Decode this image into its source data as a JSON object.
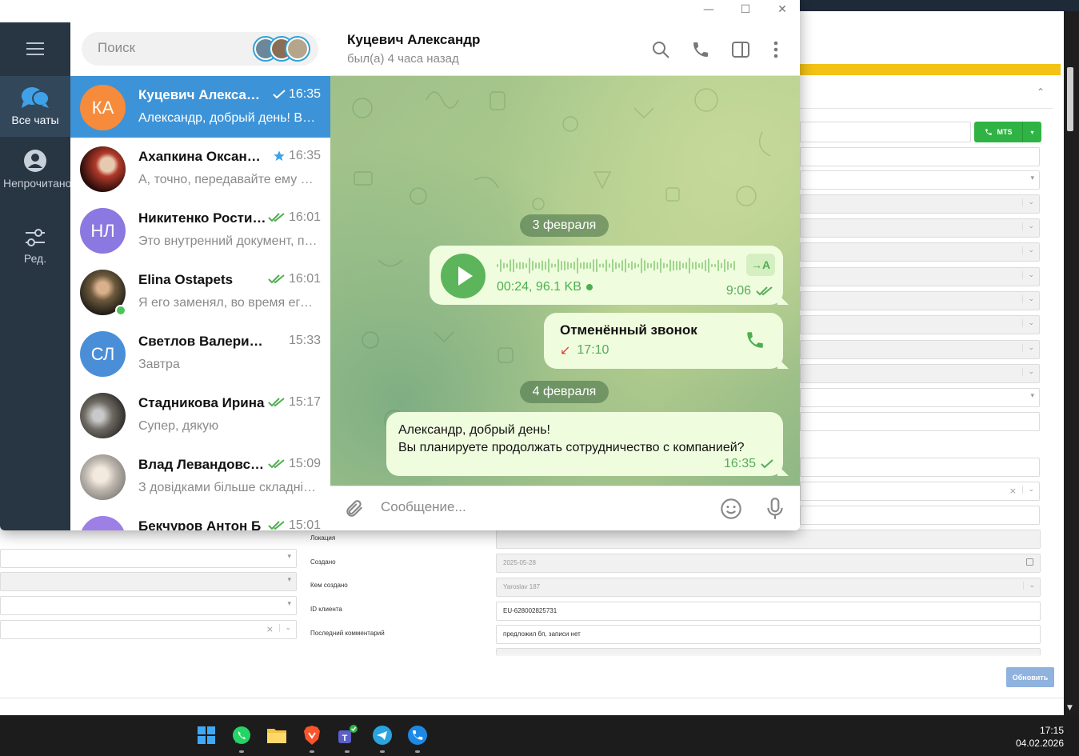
{
  "window": {
    "controls": {
      "minimize": "—",
      "maximize": "☐",
      "close": "✕"
    }
  },
  "folders": {
    "menu_icon": "hamburger-icon",
    "items": [
      {
        "label": "Все чаты",
        "icon": "chats-icon",
        "active": true
      },
      {
        "label": "Непрочитано",
        "icon": "user-icon",
        "active": false
      },
      {
        "label": "Ред.",
        "icon": "sliders-icon",
        "active": false
      }
    ]
  },
  "search": {
    "placeholder": "Поиск"
  },
  "chats": [
    {
      "initials": "КА",
      "avatar_color": "#f68b3b",
      "name": "Куцевич Александр",
      "time": "16:35",
      "status": "sent",
      "preview": "Александр, добрый день! Вы планируете продолжать сотрудничество с компанией?",
      "active": true
    },
    {
      "initials": "",
      "avatar_color": "#3a1410",
      "name": "Ахапкина Оксана Сергеевна",
      "time": "16:35",
      "status": "starred",
      "preview": "А, точно, передавайте ему привет",
      "active": false
    },
    {
      "initials": "НЛ",
      "avatar_color": "#8b78e0",
      "name": "Никитенко Ростислав Леонидович",
      "time": "16:01",
      "status": "read",
      "preview": "Это внутренний документ, поэтому",
      "active": false
    },
    {
      "initials": "",
      "avatar_color": "#3f3a2e",
      "name": "Elina Ostapets",
      "time": "16:01",
      "status": "read",
      "preview": "Я его заменял, во время его отпуска",
      "active": false,
      "online": true
    },
    {
      "initials": "СЛ",
      "avatar_color": "#4a8ed8",
      "name": "Светлов Валерий Леонидович",
      "time": "15:33",
      "status": "",
      "preview": "Завтра",
      "active": false
    },
    {
      "initials": "",
      "avatar_color": "#55504a",
      "name": "Стадникова Ирина",
      "time": "15:17",
      "status": "read",
      "preview": "Супер, дякую",
      "active": false
    },
    {
      "initials": "",
      "avatar_color": "#a9a9a9",
      "name": "Влад Левандовський",
      "time": "15:09",
      "status": "read",
      "preview": "З довідками більше складністей",
      "active": false
    },
    {
      "initials": "",
      "avatar_color": "#9d7fe6",
      "name": "Бекчуров Антон Б",
      "time": "15:01",
      "status": "read",
      "preview": "",
      "active": false
    }
  ],
  "peer": {
    "name": "Куцевич Александр",
    "status": "был(а) 4 часа назад"
  },
  "header_icons": [
    "search-icon",
    "phone-icon",
    "sidebar-icon",
    "more-icon"
  ],
  "messages": {
    "date1": "3 февраля",
    "voice": {
      "duration": "00:24, 96.1 KB",
      "time": "9:06",
      "transcribe": "→A"
    },
    "call": {
      "title": "Отменённый звонок",
      "time": "17:10"
    },
    "date2": "4 февраля",
    "text": {
      "line1": "Александр, добрый день!",
      "line2": "Вы планируете продолжать сотрудничество с компанией?",
      "time": "16:35"
    }
  },
  "composer": {
    "placeholder": "Сообщение..."
  },
  "crm": {
    "phone_button": "MTS",
    "labels": {
      "location": "Локация",
      "created": "Создано",
      "created_by": "Кем создано",
      "client_id": "ID клиента",
      "last_comment": "Последний комментарий"
    },
    "values": {
      "created": "2025-05-28",
      "created_by": "Yaroslav 187",
      "client_id": "EU-628002825731",
      "last_comment": "предложил бп, записи нет"
    },
    "refresh_button": "Обновить"
  },
  "taskbar": {
    "icons": [
      "windows-start-icon",
      "whatsapp-icon",
      "file-explorer-icon",
      "brave-icon",
      "teams-icon",
      "telegram-icon",
      "phone-app-icon"
    ],
    "time": "17:15",
    "date": "04.02.2026"
  }
}
